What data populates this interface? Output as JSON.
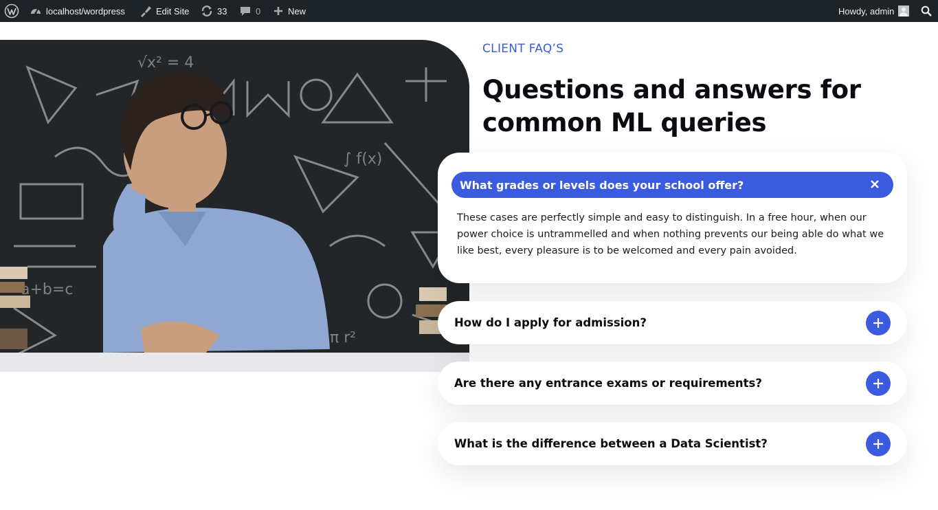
{
  "adminbar": {
    "site": "localhost/wordpress",
    "edit_site": "Edit Site",
    "updates_count": "33",
    "comments_count": "0",
    "new_label": "New",
    "howdy": "Howdy, admin",
    "colors": {
      "bg": "#1d2327",
      "text": "#f0f0f1"
    },
    "icons": [
      "wordpress-logo-icon",
      "dashboard-icon",
      "brush-icon",
      "updates-icon",
      "comment-icon",
      "plus-icon",
      "avatar",
      "search-icon"
    ]
  },
  "section": {
    "eyebrow": "CLIENT FAQ’S",
    "title": "Questions and answers for common ML queries"
  },
  "faq": {
    "accent": "#3a5be0",
    "open": {
      "question": "What grades or levels does your school offer?",
      "answer": "These cases are perfectly simple and easy to distinguish. In a free hour, when our power choice is untrammelled and when nothing prevents our being able do what we like best, every pleasure is to be welcomed and every pain avoided."
    },
    "items": [
      {
        "question": "How do I apply for admission?"
      },
      {
        "question": "Are there any entrance exams or requirements?"
      },
      {
        "question": "What is the difference between a Data Scientist?"
      }
    ]
  }
}
